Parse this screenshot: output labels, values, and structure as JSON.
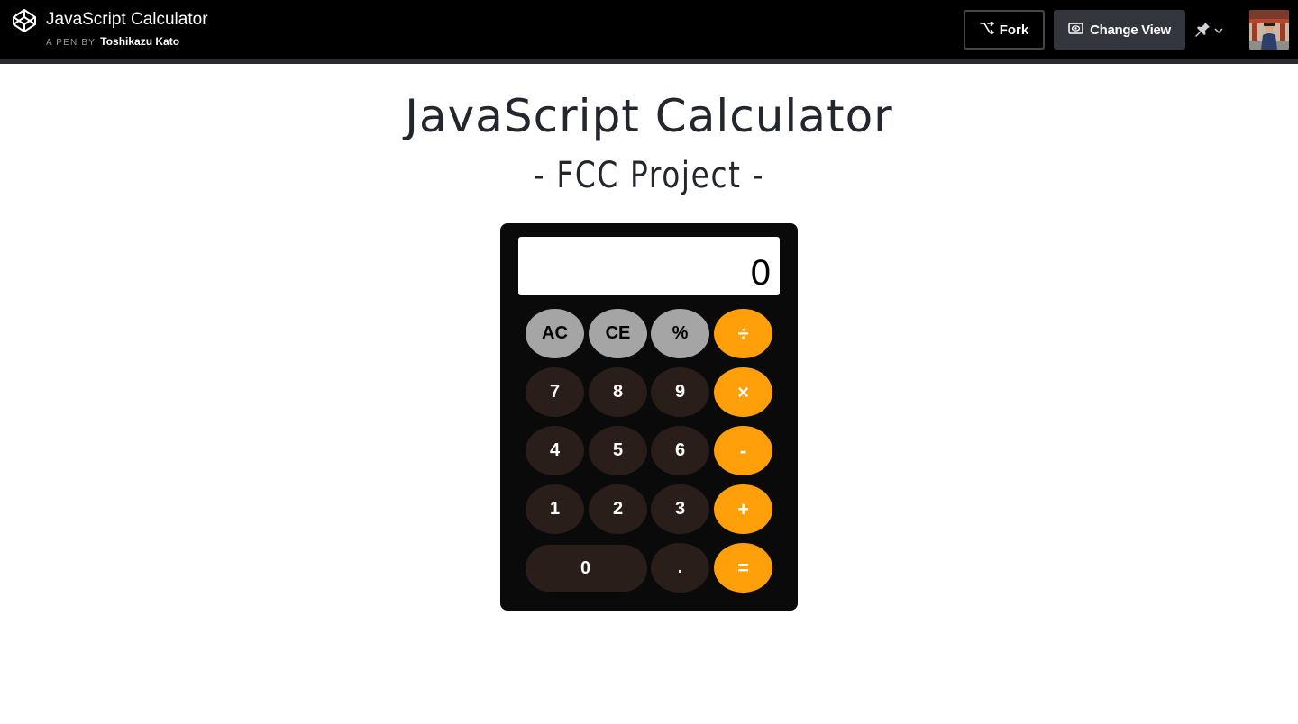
{
  "header": {
    "pen_title": "JavaScript Calculator",
    "pen_by_label": "A PEN BY",
    "author": "Toshikazu Kato",
    "fork_label": "Fork",
    "change_view_label": "Change View",
    "icons": {
      "logo": "codepen-logo-icon",
      "fork": "fork-icon",
      "change_view": "eye-icon",
      "pin": "pin-icon",
      "dropdown": "chevron-down-icon"
    }
  },
  "page": {
    "title": "JavaScript Calculator",
    "subtitle": "- FCC Project -"
  },
  "calculator": {
    "display_value": "0",
    "keys": {
      "ac": "AC",
      "ce": "CE",
      "percent": "%",
      "divide": "÷",
      "seven": "7",
      "eight": "8",
      "nine": "9",
      "multiply": "×",
      "four": "4",
      "five": "5",
      "six": "6",
      "subtract": "-",
      "one": "1",
      "two": "2",
      "three": "3",
      "add": "+",
      "zero": "0",
      "decimal": ".",
      "equals": "="
    }
  },
  "colors": {
    "topbar_bg": "#000000",
    "change_view_bg": "#34363e",
    "calc_body": "#0a0a0a",
    "func_key": "#a5a5a5",
    "num_key": "#2a1e1b",
    "op_key": "#ff9f0a",
    "heading_text": "#23272d"
  }
}
